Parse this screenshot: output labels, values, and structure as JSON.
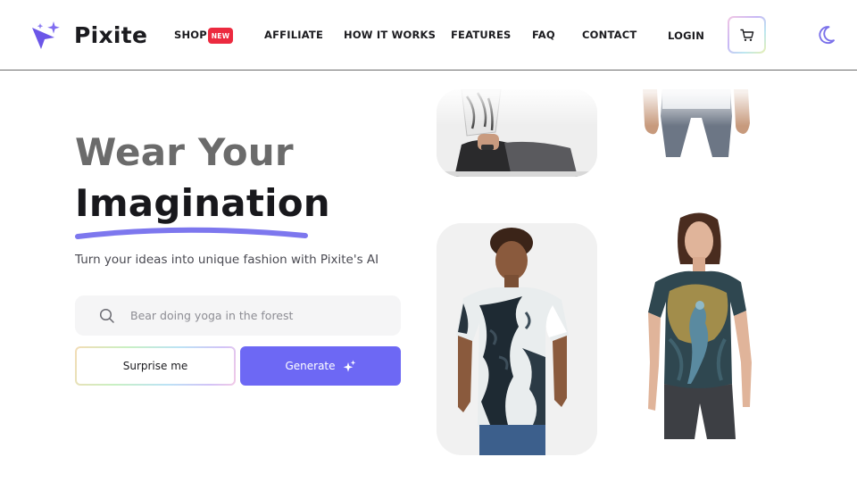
{
  "brand": {
    "name": "Pixite",
    "accent": "#6d68f4",
    "badge_color": "#ec2a3f"
  },
  "nav": {
    "shop": "SHOP",
    "shop_badge": "NEW",
    "affiliate": "AFFILIATE",
    "how_it_works": "HOW IT WORKS",
    "features": "FEATURES",
    "faq": "FAQ",
    "contact": "CONTACT",
    "login": "LOGIN"
  },
  "icons": {
    "logo": "sparkle-arrow-logo-icon",
    "cart": "shopping-cart-icon",
    "theme": "moon-icon",
    "search": "search-icon",
    "generate": "sparkle-icon"
  },
  "hero": {
    "title_line1": "Wear Your",
    "title_line2": "Imagination",
    "subtitle": "Turn your ideas into unique fashion with Pixite's AI"
  },
  "search": {
    "placeholder": "Bear doing yoga in the forest",
    "value": ""
  },
  "actions": {
    "surprise_label": "Surprise me",
    "generate_label": "Generate"
  }
}
